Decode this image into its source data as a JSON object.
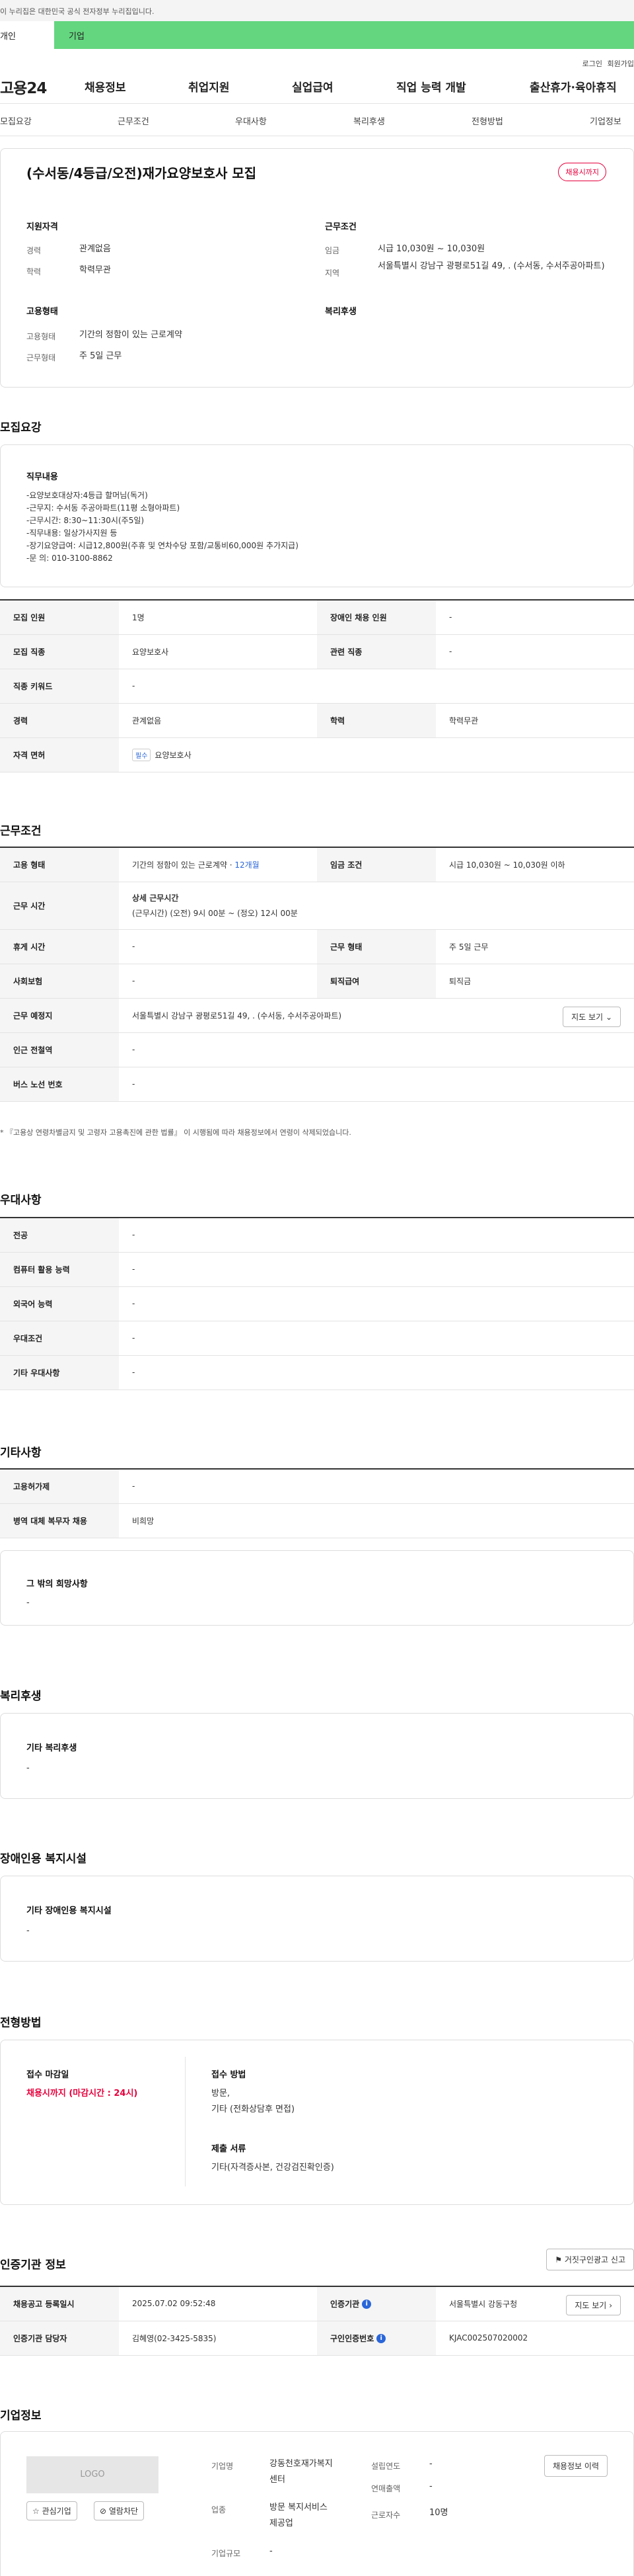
{
  "gov_banner": "이 누리집은 대한민국 공식 전자정부 누리집입니다.",
  "user_tabs": [
    "개인",
    "기업"
  ],
  "util": {
    "login": "로그인",
    "signup": "회원가입"
  },
  "logo": "고용24",
  "gnb": [
    "채용정보",
    "취업지원",
    "실업급여",
    "직업 능력 개발",
    "출산휴가·육아휴직"
  ],
  "subnav": [
    "모집요강",
    "근무조건",
    "우대사항",
    "복리후생",
    "전형방법",
    "기업정보"
  ],
  "job": {
    "title": "(수서동/4등급/오전)재가요양보호사 모집",
    "badge": "채용시까지",
    "qualify_head": "지원자격",
    "work_head": "근무조건",
    "career_label": "경력",
    "career_value": "관계없음",
    "edu_label": "학력",
    "edu_value": "학력무관",
    "wage_label": "임금",
    "wage_value": "시급 10,030원 ~ 10,030원",
    "area_label": "지역",
    "area_value": "서울특별시 강남구 광평로51길 49, . (수서동, 수서주공아파트)",
    "emp_head": "고용형태",
    "welfare_head": "복리후생",
    "emp_type_label": "고용형태",
    "emp_type_value": "기간의 정함이 있는 근로계약",
    "work_form_label": "근무형태",
    "work_form_value": "주 5일 근무"
  },
  "recruit": {
    "heading": "모집요강",
    "duty_head": "직무내용",
    "duty_lines": [
      "-요양보호대상자:4등급 할머님(독거)",
      "-근무지: 수서동 주공아파트(11평 소형아파트)",
      "-근무시간: 8:30~11:30시(주5일)",
      "-직무내용: 일상가사지원 등",
      "-장기요양급여: 시급12,800원(주휴 및 연차수당 포함/교통비60,000원 추가지급)",
      "-문 의: 010-3100-8862"
    ],
    "rows": {
      "count_label": "모집 인원",
      "count_value": "1명",
      "disabled_label": "장애인 채용 인원",
      "disabled_value": "-",
      "job_label": "모집 직종",
      "job_value": "요양보호사",
      "related_label": "관련 직종",
      "related_value": "-",
      "keyword_label": "직종 키워드",
      "keyword_value": "-",
      "career_label": "경력",
      "career_value": "관계없음",
      "edu_label": "학력",
      "edu_value": "학력무관",
      "license_label": "자격 면허",
      "license_tag": "필수",
      "license_value": "요양보호사"
    }
  },
  "work": {
    "heading": "근무조건",
    "emp_label": "고용 형태",
    "emp_value": "기간의 정함이 있는 근로계약 · ",
    "emp_months": "12개월",
    "wage_label": "임금 조건",
    "wage_value": "시급 10,030원 ~ 10,030원 이하",
    "time_label": "근무 시간",
    "time_head": "상세 근무시간",
    "time_value": "(근무시간) (오전) 9시 00분 ~ (정오) 12시 00분",
    "rest_label": "휴게 시간",
    "rest_value": "-",
    "form_label": "근무 형태",
    "form_value": "주 5일 근무",
    "insurance_label": "사회보험",
    "insurance_value": "-",
    "severance_label": "퇴직급여",
    "severance_value": "퇴직금",
    "place_label": "근무 예정지",
    "place_value": "서울특별시 강남구 광평로51길 49, . (수서동, 수서주공아파트)",
    "map_btn": "지도 보기",
    "subway_label": "인근 전철역",
    "subway_value": "-",
    "bus_label": "버스 노선 번호",
    "bus_value": "-",
    "note": "* 『고용상 연령차별금지 및 고령자 고용촉진에 관한 법률』 이 시행됨에 따라 채용정보에서 연령이 삭제되었습니다."
  },
  "pref": {
    "heading": "우대사항",
    "major_label": "전공",
    "major_value": "-",
    "computer_label": "컴퓨터 활용 능력",
    "computer_value": "-",
    "lang_label": "외국어 능력",
    "lang_value": "-",
    "cond_label": "우대조건",
    "cond_value": "-",
    "etc_label": "기타 우대사항",
    "etc_value": "-"
  },
  "other": {
    "heading": "기타사항",
    "dorm_label": "고용허가제",
    "dorm_value": "-",
    "military_label": "병역 대체 복무자 채용",
    "military_value": "비희망",
    "wish_head": "그 밖의 희망사항",
    "wish_value": "-"
  },
  "welfare": {
    "heading": "복리후생",
    "sub": "기타 복리후생",
    "value": "-"
  },
  "disabled": {
    "heading": "장애인용 복지시설",
    "sub": "기타 장애인용 복지시설",
    "value": "-"
  },
  "selection": {
    "heading": "전형방법",
    "deadline_head": "접수 마감일",
    "deadline_value": "채용시까지 (마감시간 : 24시)",
    "method_head": "접수 방법",
    "method_value_1": "방문,",
    "method_value_2": "기타 (전화상담후 면접)",
    "docs_head": "제출 서류",
    "docs_value": "기타(자격증사본, 건강검진확인증)"
  },
  "cert": {
    "heading": "인증기관 정보",
    "report_btn": "거짓구인광고 신고",
    "reg_label": "채용공고 등록일시",
    "reg_value": "2025.07.02 09:52:48",
    "org_label": "인증기관",
    "org_value": "서울특별시 강동구청",
    "map_btn": "지도 보기",
    "staff_label": "인증기관 담당자",
    "staff_value": "김혜영(02-3425-5835)",
    "code_label": "구인인증번호",
    "code_value": "KJAC002507020002"
  },
  "company": {
    "heading": "기업정보",
    "logo": "LOGO",
    "fav_btn": "관심기업",
    "block_btn": "열람차단",
    "name_label": "기업명",
    "name_value_1": "강동천호재가복지",
    "name_value_2": "센터",
    "year_label": "설립연도",
    "year_value": "-",
    "sales_label": "연매출액",
    "sales_value": "-",
    "industry_label": "업종",
    "industry_value_1": "방문 복지서비스",
    "industry_value_2": "제공업",
    "staff_label": "근로자수",
    "staff_value": "10명",
    "size_label": "기업규모",
    "size_value": "-",
    "jobs_btn": "채용정보 이력"
  },
  "colors": {
    "green": "#64d67f",
    "accent_red": "#e6003c",
    "blue": "#2a66d9"
  }
}
